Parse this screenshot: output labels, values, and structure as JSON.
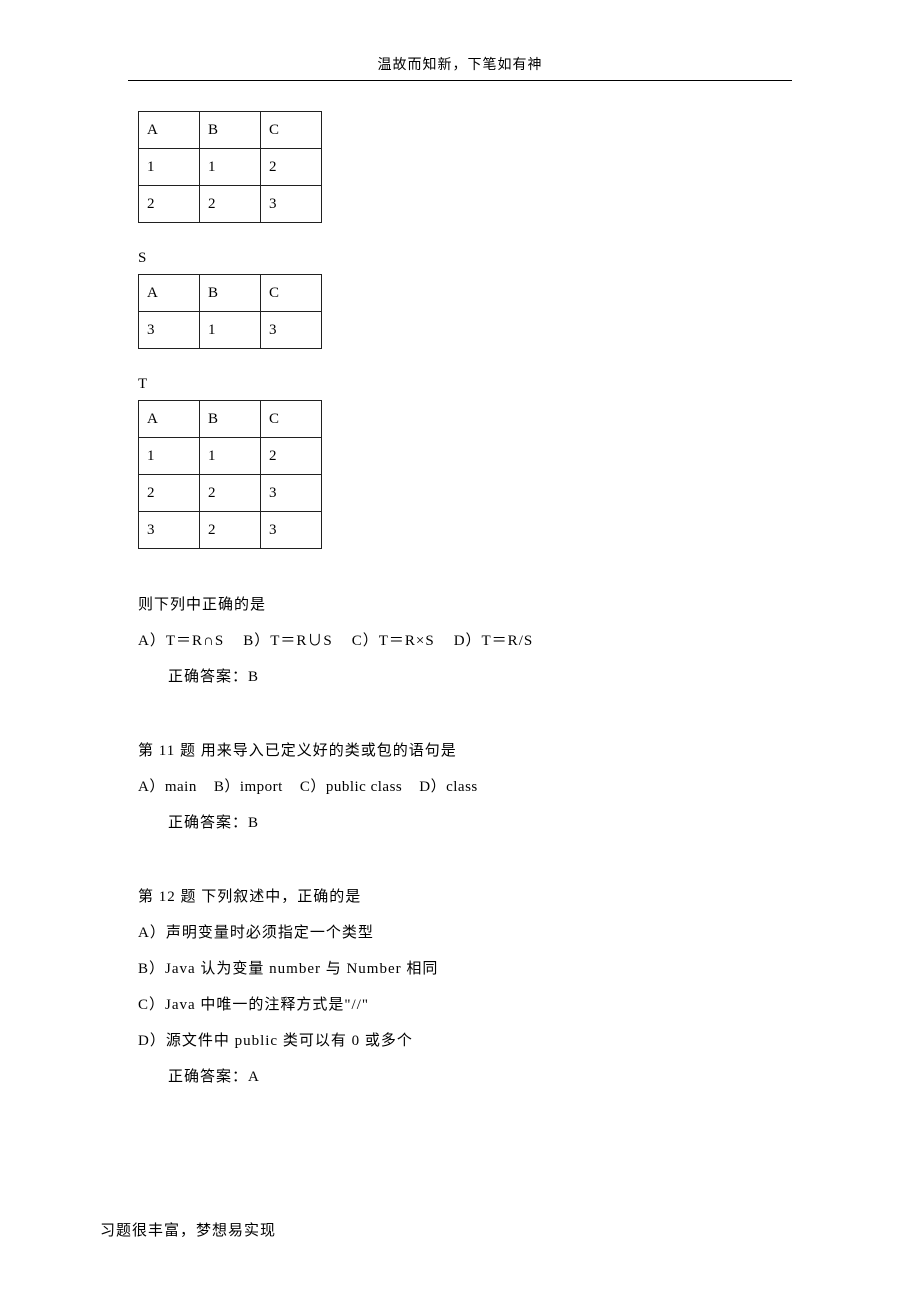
{
  "header": {
    "title": "温故而知新，下笔如有神"
  },
  "table_R": {
    "headers": [
      "A",
      "B",
      "C"
    ],
    "rows": [
      [
        "1",
        "1",
        "2"
      ],
      [
        "2",
        "2",
        "3"
      ]
    ]
  },
  "table_S": {
    "label": "S",
    "headers": [
      "A",
      "B",
      "C"
    ],
    "rows": [
      [
        "3",
        "1",
        "3"
      ]
    ]
  },
  "table_T": {
    "label": "T",
    "headers": [
      "A",
      "B",
      "C"
    ],
    "rows": [
      [
        "1",
        "1",
        "2"
      ],
      [
        "2",
        "2",
        "3"
      ],
      [
        "3",
        "2",
        "3"
      ]
    ]
  },
  "q10": {
    "prompt": "则下列中正确的是",
    "options": {
      "A": "A）T＝R∩S",
      "B": "B）T＝R∪S",
      "C": "C）T＝R×S",
      "D": "D）T＝R/S"
    },
    "answer": "正确答案：B"
  },
  "q11": {
    "title": "第 11 题 用来导入已定义好的类或包的语句是",
    "options": {
      "A": "A）main",
      "B": "B）import",
      "C": "C）public  class",
      "D": "D）class"
    },
    "answer": "正确答案：B"
  },
  "q12": {
    "title": "第 12 题 下列叙述中，正确的是",
    "options": {
      "A": "A）声明变量时必须指定一个类型",
      "B": "B）Java 认为变量 number 与 Number 相同",
      "C": "C）Java 中唯一的注释方式是\"//\"",
      "D": "D）源文件中 public 类可以有 0 或多个"
    },
    "answer": "正确答案：A"
  },
  "footer": {
    "text": "习题很丰富，梦想易实现"
  }
}
